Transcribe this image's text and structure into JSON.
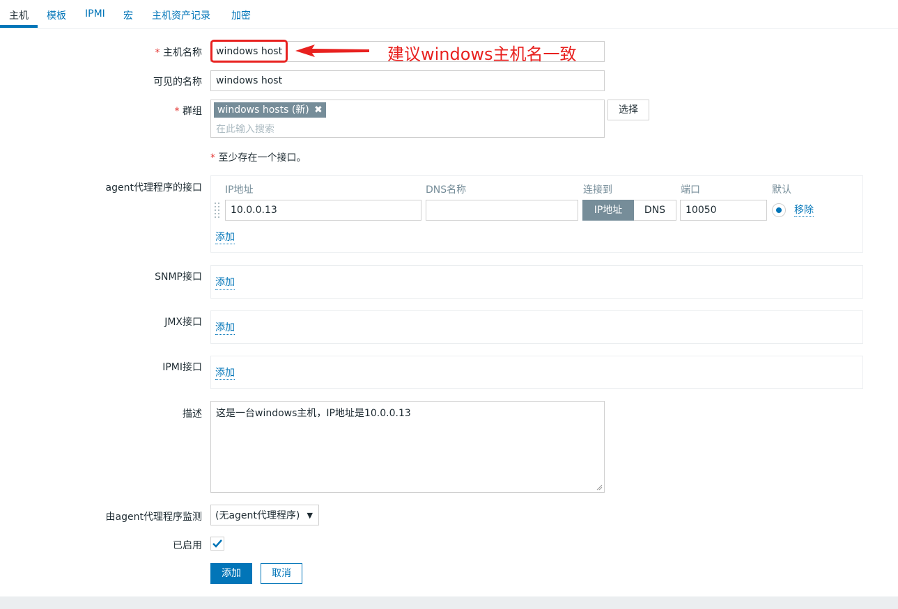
{
  "tabs": [
    "主机",
    "模板",
    "IPMI",
    "宏",
    "主机资产记录",
    "加密"
  ],
  "form": {
    "hostname_label": "主机名称",
    "hostname_value": "windows host",
    "visible_name_label": "可见的名称",
    "visible_name_value": "windows host",
    "groups_label": "群组",
    "group_tag": "windows hosts (新)",
    "groups_placeholder": "在此输入搜索",
    "select_button": "选择",
    "interface_notice": "至少存在一个接口。",
    "required_mark": "*",
    "agent_interfaces_label": "agent代理程序的接口",
    "columns": {
      "ip": "IP地址",
      "dns": "DNS名称",
      "connect_to": "连接到",
      "port": "端口",
      "default": "默认"
    },
    "agent_ip_value": "10.0.0.13",
    "agent_dns_value": "",
    "connect_ip_option": "IP地址",
    "connect_dns_option": "DNS",
    "agent_port_value": "10050",
    "remove_link": "移除",
    "add_link": "添加",
    "snmp_label": "SNMP接口",
    "jmx_label": "JMX接口",
    "ipmi_label": "IPMI接口",
    "description_label": "描述",
    "description_value": "这是一台windows主机，IP地址是10.0.0.13",
    "proxy_label": "由agent代理程序监测",
    "proxy_value": "(无agent代理程序)",
    "enabled_label": "已启用",
    "enabled_checked": true,
    "add_button": "添加",
    "cancel_button": "取消"
  },
  "annotation": {
    "text": "建议windows主机名一致"
  },
  "colors": {
    "accent": "#0275b8",
    "annotation_red": "#e8211f",
    "active_toggle": "#768d99",
    "required_red": "#e33734"
  }
}
